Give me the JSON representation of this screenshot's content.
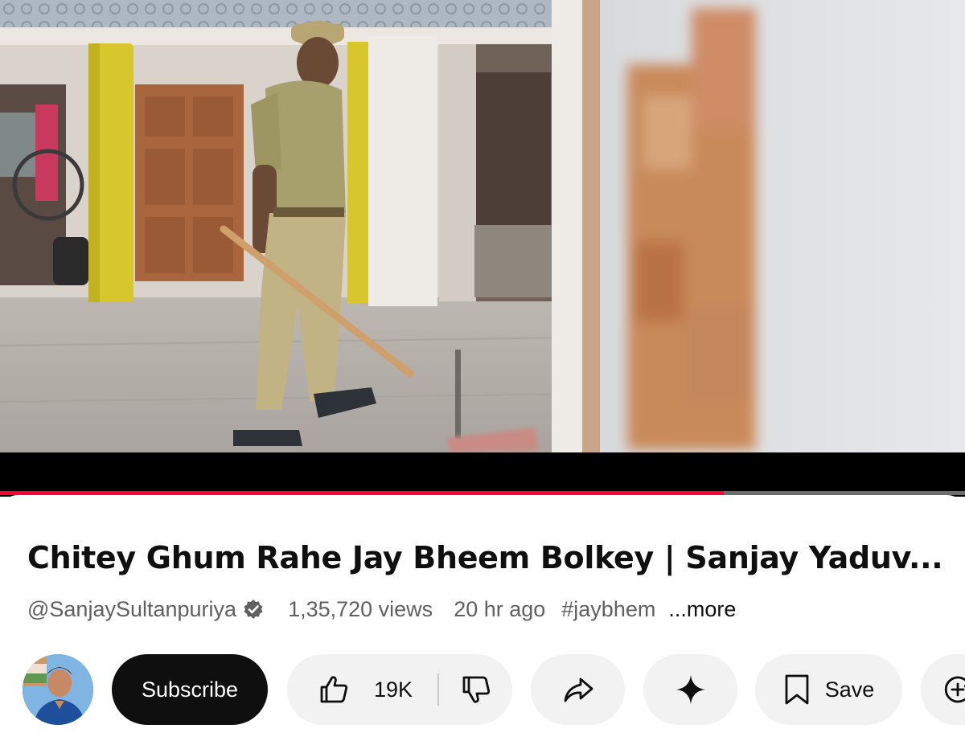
{
  "video": {
    "progress_fraction": 0.75
  },
  "colors": {
    "progress_played": "#ff0033",
    "progress_track": "#6d6d6d",
    "subscribe_bg": "#0f0f0f",
    "pill_bg": "#f2f2f2",
    "meta_text": "#606060"
  },
  "info": {
    "title": "Chitey Ghum Rahe Jay Bheem Bolkey | Sanjay Yaduv...",
    "channel_handle": "@SanjaySultanpuriya",
    "views": "1,35,720 views",
    "age": "20 hr ago",
    "hashtag": "#jaybhem",
    "more_label": "...more"
  },
  "actions": {
    "subscribe_label": "Subscribe",
    "like_count": "19K",
    "save_label": "Save"
  },
  "icons": {
    "verified": "verified-badge-icon",
    "like": "thumbs-up-icon",
    "dislike": "thumbs-down-icon",
    "share": "share-arrow-icon",
    "ask": "sparkle-icon",
    "save": "bookmark-icon",
    "remix": "remix-icon"
  }
}
